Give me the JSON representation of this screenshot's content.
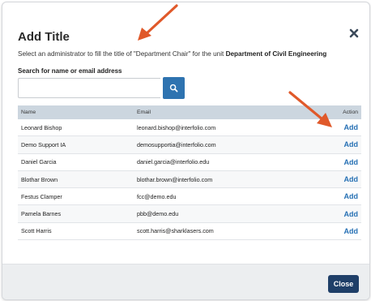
{
  "modal": {
    "title": "Add Title",
    "instruction_prefix": "Select an administrator to fill the title of \"Department Chair\" for the unit ",
    "instruction_unit": "Department of Civil Engineering"
  },
  "search": {
    "label": "Search for name or email address",
    "value": "",
    "placeholder": ""
  },
  "table": {
    "headers": {
      "name": "Name",
      "email": "Email",
      "action": "Action"
    },
    "rows": [
      {
        "name": "Leonard Bishop",
        "email": "leonard.bishop@interfolio.com",
        "action": "Add"
      },
      {
        "name": "Demo Support IA",
        "email": "demosupportia@interfolio.com",
        "action": "Add"
      },
      {
        "name": "Daniel Garcia",
        "email": "daniel.garcia@interfolio.edu",
        "action": "Add"
      },
      {
        "name": "Blothar Brown",
        "email": "blothar.brown@interfolio.com",
        "action": "Add"
      },
      {
        "name": "Festus Clamper",
        "email": "fcc@demo.edu",
        "action": "Add"
      },
      {
        "name": "Pamela Barnes",
        "email": "pbb@demo.edu",
        "action": "Add"
      },
      {
        "name": "Scott Harris",
        "email": "scott.harris@sharklasers.com",
        "action": "Add"
      }
    ]
  },
  "footer": {
    "close_label": "Close"
  },
  "colors": {
    "primary_button": "#1f3f68",
    "search_button": "#2e73b0",
    "link": "#2670b4",
    "table_header": "#ccd6df",
    "annotation_arrow": "#e0592a"
  },
  "icons": {
    "close": "close-x-icon",
    "search": "search-icon",
    "annotation": "arrow-icon"
  }
}
